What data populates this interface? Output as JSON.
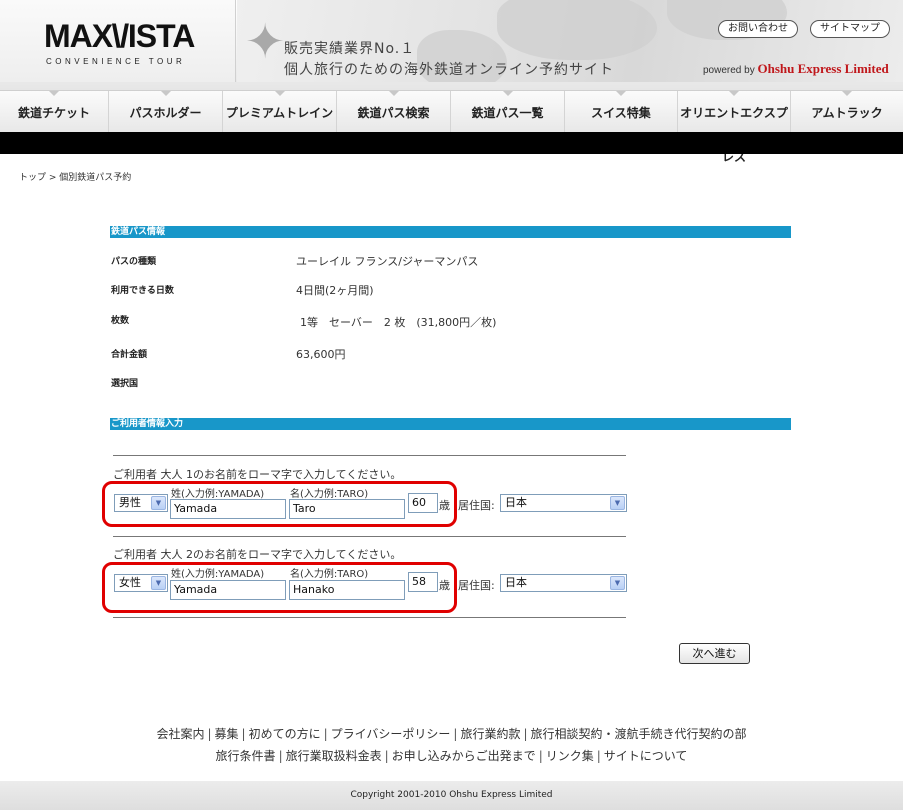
{
  "header": {
    "logo_main": "MAX",
    "logo_v": "\\/",
    "logo_rest": "ISTA",
    "logo_sub": "CONVENIENCE TOUR",
    "tagline1": "販売実績業界No.１",
    "tagline2": "個人旅行のための海外鉄道オンライン予約サイト",
    "contact_button": "お問い合わせ",
    "sitemap_button": "サイトマップ",
    "powered_prefix": "powered by",
    "powered_company": "Ohshu Express Limited"
  },
  "nav": {
    "items": [
      {
        "label": "鉄道チケット"
      },
      {
        "label": "パスホルダー"
      },
      {
        "label": "プレミアムトレイン"
      },
      {
        "label": "鉄道パス検索"
      },
      {
        "label": "鉄道パス一覧"
      },
      {
        "label": "スイス特集"
      },
      {
        "label": "オリエントエクスプレス"
      },
      {
        "label": "アムトラック"
      }
    ]
  },
  "breadcrumb": {
    "home": "トップ",
    "separator": " > ",
    "current": "個別鉄道パス予約"
  },
  "pass_info": {
    "section_title": "鉄道パス情報",
    "rows": [
      {
        "label": "パスの種類",
        "value": "ユーレイル フランス/ジャーマンパス"
      },
      {
        "label": "利用できる日数",
        "value": "4日間(2ヶ月間)"
      },
      {
        "label": "枚数",
        "value": "1等　セーバー　2 枚　(31,800円／枚)"
      },
      {
        "label": "合計金額",
        "value": "63,600円"
      },
      {
        "label": "選択国",
        "value": ""
      }
    ]
  },
  "user_info": {
    "section_title": "ご利用者情報入力",
    "travelers": [
      {
        "prompt": "ご利用者 大人 1のお名前をローマ字で入力してください。",
        "gender": "男性",
        "surname_label": "姓(入力例:YAMADA)",
        "surname": "Yamada",
        "given_label": "名(入力例:TARO)",
        "given": "Taro",
        "age": "60",
        "age_unit": "歳",
        "residence_label": "居住国:",
        "residence": "日本"
      },
      {
        "prompt": "ご利用者 大人 2のお名前をローマ字で入力してください。",
        "gender": "女性",
        "surname_label": "姓(入力例:YAMADA)",
        "surname": "Yamada",
        "given_label": "名(入力例:TARO)",
        "given": "Hanako",
        "age": "58",
        "age_unit": "歳",
        "residence_label": "居住国:",
        "residence": "日本"
      }
    ],
    "next_button": "次へ進む"
  },
  "footer": {
    "line1": [
      "会社案内",
      "募集",
      "初めての方に",
      "プライバシーポリシー",
      "旅行業約款",
      "旅行相談契約・渡航手続き代行契約の部"
    ],
    "line2": [
      "旅行条件書",
      "旅行業取扱料金表",
      "お申し込みからご出発まで",
      "リンク集",
      "サイトについて"
    ],
    "separator": "|",
    "copyright": "Copyright 2001-2010 Ohshu Express Limited"
  },
  "colors": {
    "section_header": "#1897c9",
    "highlight_box": "#e00000",
    "powered_company": "#c0171b"
  }
}
